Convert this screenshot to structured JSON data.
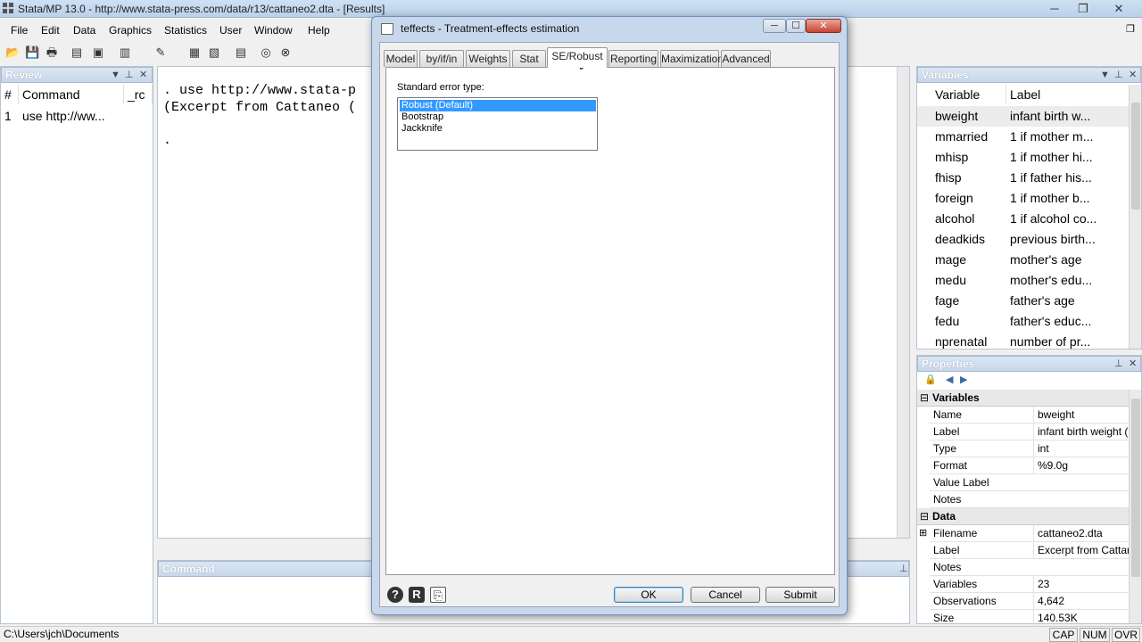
{
  "window": {
    "title": "Stata/MP 13.0 - http://www.stata-press.com/data/r13/cattaneo2.dta - [Results]",
    "controls": {
      "minimize": "─",
      "restore": "❐",
      "close": "✕"
    }
  },
  "menu": [
    "File",
    "Edit",
    "Data",
    "Graphics",
    "Statistics",
    "User",
    "Window",
    "Help"
  ],
  "review": {
    "header": "Review",
    "columns": [
      "#",
      "Command",
      "_rc"
    ],
    "rows": [
      {
        "num": "1",
        "command": "use http://ww..."
      }
    ]
  },
  "results": {
    "lines": [
      ". use http://www.stata-p",
      "(Excerpt from Cattaneo (",
      "",
      "."
    ]
  },
  "command": {
    "header": "Command"
  },
  "variables": {
    "header": "Variables",
    "columns": [
      "Variable",
      "Label"
    ],
    "rows": [
      {
        "name": "bweight",
        "label": "infant birth w..."
      },
      {
        "name": "mmarried",
        "label": "1 if mother m..."
      },
      {
        "name": "mhisp",
        "label": "1 if mother hi..."
      },
      {
        "name": "fhisp",
        "label": "1 if father his..."
      },
      {
        "name": "foreign",
        "label": "1 if mother b..."
      },
      {
        "name": "alcohol",
        "label": "1 if alcohol co..."
      },
      {
        "name": "deadkids",
        "label": "previous birth..."
      },
      {
        "name": "mage",
        "label": "mother's age"
      },
      {
        "name": "medu",
        "label": "mother's edu..."
      },
      {
        "name": "fage",
        "label": "father's age"
      },
      {
        "name": "fedu",
        "label": "father's educ..."
      },
      {
        "name": "nprenatal",
        "label": "number of pr..."
      }
    ]
  },
  "properties": {
    "header": "Properties",
    "sections": {
      "variables": "Variables",
      "data": "Data"
    },
    "variable_props": [
      {
        "key": "Name",
        "value": "bweight"
      },
      {
        "key": "Label",
        "value": "infant birth weight ("
      },
      {
        "key": "Type",
        "value": "int"
      },
      {
        "key": "Format",
        "value": "%9.0g"
      },
      {
        "key": "Value Label",
        "value": ""
      },
      {
        "key": "Notes",
        "value": ""
      }
    ],
    "data_props": [
      {
        "key": "Filename",
        "value": "cattaneo2.dta"
      },
      {
        "key": "Label",
        "value": "Excerpt from Cattane"
      },
      {
        "key": "Notes",
        "value": ""
      },
      {
        "key": "Variables",
        "value": "23"
      },
      {
        "key": "Observations",
        "value": "4,642"
      },
      {
        "key": "Size",
        "value": "140.53K"
      }
    ]
  },
  "status": {
    "path": "C:\\Users\\jch\\Documents",
    "indicators": [
      "CAP",
      "NUM",
      "OVR"
    ]
  },
  "dialog": {
    "title": "teffects - Treatment-effects estimation",
    "tabs": [
      "Model",
      "by/if/in",
      "Weights",
      "Stat",
      "SE/Robust",
      "Reporting",
      "Maximization",
      "Advanced"
    ],
    "active_tab": "SE/Robust",
    "se_label": "Standard error type:",
    "se_options": [
      "Robust (Default)",
      "Bootstrap",
      "Jackknife"
    ],
    "se_selected": "Robust (Default)",
    "buttons": {
      "ok": "OK",
      "cancel": "Cancel",
      "submit": "Submit"
    },
    "icons": {
      "help": "?",
      "reset": "R",
      "copy": "⎘"
    }
  },
  "colors": {
    "selection": "#3399ff",
    "titlebar": "#b9d1ea",
    "dialog_frame": "#c8d8ec"
  }
}
